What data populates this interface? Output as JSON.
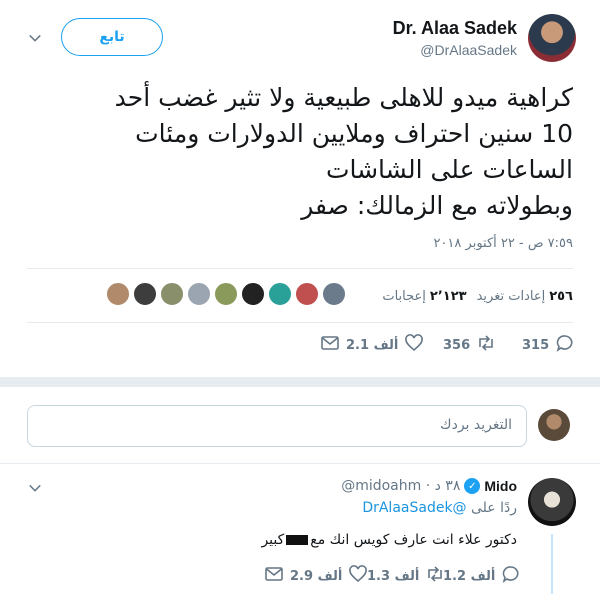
{
  "tweet": {
    "author": {
      "name": "Dr. Alaa Sadek",
      "handle": "@DrAlaaSadek"
    },
    "follow_label": "تابع",
    "text_lines": [
      "كراهية ميدو للاهلى طبيعية ولا تثير غضب أحد",
      "10 سنين احتراف وملايين الدولارات ومئات",
      "الساعات على الشاشات",
      "وبطولاته مع الزمالك: صفر"
    ],
    "timestamp": "٧:٥٩ ص - ٢٢ أكتوبر ٢٠١٨",
    "stats": {
      "retweets_num": "٢٥٦",
      "retweets_label": "إعادات تغريد",
      "likes_num": "٢٬١٢٣",
      "likes_label": "إعجابات"
    },
    "likers_colors": [
      "#6b7b8c",
      "#c05050",
      "#2aa198",
      "#222222",
      "#8a9a5b",
      "#9aa5b1",
      "#8a8f6b",
      "#3d3d3d",
      "#b08a6a"
    ],
    "actions": {
      "replies": "315",
      "retweets": "356",
      "likes": "2.1 ألف"
    }
  },
  "composer": {
    "placeholder": "التغريد بردك"
  },
  "reply": {
    "name": "Mido",
    "verified_mark": "✓",
    "meta": "@midoahm · ٣٨ د",
    "reply_to_prefix": "ردًا على",
    "reply_to_handle": "@DrAlaaSadek",
    "text_before": "دكتور علاء انت عارف كويس انك مع",
    "text_after": "كبير",
    "actions": {
      "replies": "1.2 ألف",
      "retweets": "1.3 ألف",
      "likes": "2.9 ألف"
    }
  },
  "colors": {
    "accent": "#1da1f2",
    "muted": "#657786",
    "divider": "#e6ecf0"
  }
}
